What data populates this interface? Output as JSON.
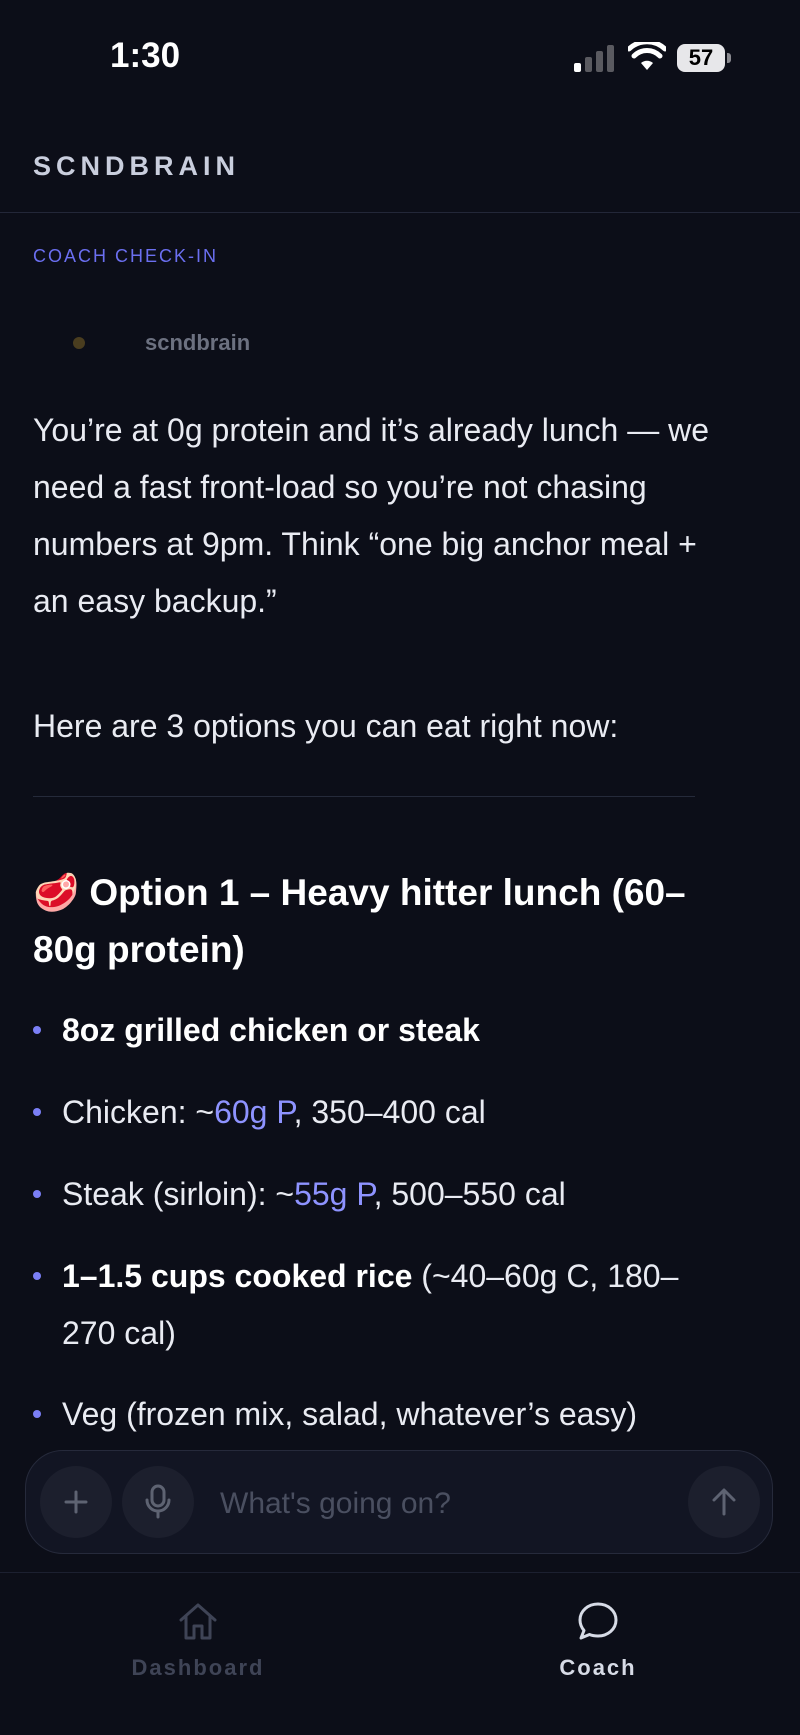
{
  "status_bar": {
    "time": "1:30",
    "battery_level": "57"
  },
  "header": {
    "title": "SCNDBRAIN"
  },
  "message": {
    "label": "COACH CHECK-IN",
    "sender": "scndbrain",
    "paragraph_1": "You’re at 0g protein and it’s already lunch — we need a fast front-load so you’re not chasing numbers at 9pm. Think “one big anchor meal + an easy backup.”",
    "paragraph_2": "Here are 3 options you can eat right now:",
    "option_title_emoji": "🥩",
    "option_title": "Option 1 – Heavy hitter lunch (60–80g protein)",
    "bullets": [
      {
        "bold": "8oz grilled chicken or steak"
      },
      {
        "prefix": "Chicken: ~",
        "highlight": "60g P",
        "suffix": ", 350–400 cal"
      },
      {
        "prefix": "Steak (sirloin): ~",
        "highlight": "55g P",
        "suffix": ", 500–550 cal"
      },
      {
        "bold": "1–1.5 cups cooked rice",
        "suffix": " (~40–60g C, 180–270 cal)"
      },
      {
        "text": "Veg (frozen mix, salad, whatever’s easy)"
      }
    ]
  },
  "composer": {
    "placeholder": "What's going on?",
    "add_icon": "plus-icon",
    "mic_icon": "microphone-icon",
    "send_icon": "arrow-up-icon"
  },
  "tabs": [
    {
      "label": "Dashboard",
      "icon": "home-icon",
      "active": false
    },
    {
      "label": "Coach",
      "icon": "chat-bubble-icon",
      "active": true
    }
  ],
  "colors": {
    "background": "#0c0e18",
    "accent": "#7b7ff6",
    "highlight": "#8e93ff",
    "text": "#e9ebf2"
  }
}
